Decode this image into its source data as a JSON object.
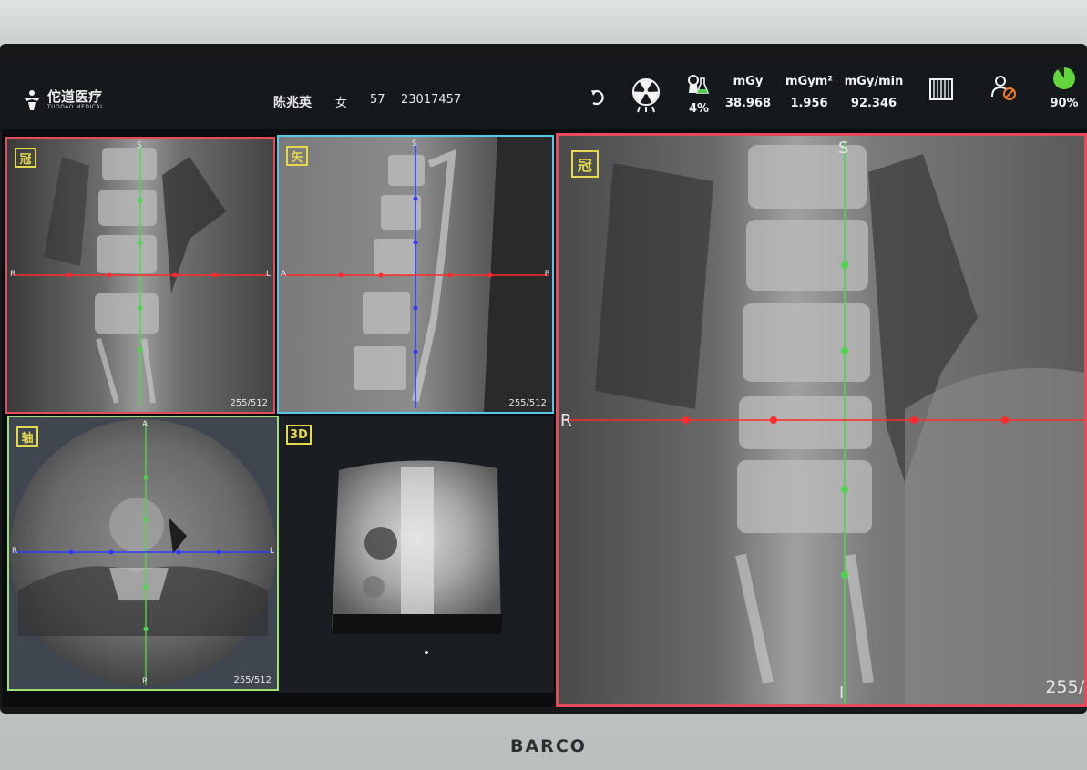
{
  "app": {
    "logo_cn": "佗道医疗",
    "logo_en": "TUODAO MEDICAL"
  },
  "patient": {
    "name": "陈兆英",
    "sex": "女",
    "age": "57",
    "id": "23017457"
  },
  "status": {
    "icons": [
      "return-icon",
      "radiation-icon",
      "contrast-flask-icon",
      "grid-icon",
      "user-block-icon",
      "battery-pie-icon"
    ],
    "contrast_pct": "4%",
    "dose_mgy_label": "mGy",
    "dose_mgy_value": "38.968",
    "dap_label": "mGym²",
    "dap_value": "1.956",
    "rate_label": "mGy/min",
    "rate_value": "92.346",
    "battery_pct": "90%",
    "battery_level": 0.9
  },
  "viewports": {
    "coronal": {
      "tag": "冠",
      "slice": "255/512",
      "top": "S",
      "left": "R",
      "right": "L"
    },
    "sagittal": {
      "tag": "矢",
      "slice": "255/512",
      "top": "S",
      "left": "A",
      "right": "P"
    },
    "axial": {
      "tag": "轴",
      "slice": "255/512",
      "top": "A",
      "bottom": "P",
      "left": "R",
      "right": "L"
    },
    "render3d": {
      "tag": "3D"
    },
    "main": {
      "tag": "冠",
      "slice": "255/",
      "top": "S",
      "left": "R",
      "bottom": "I"
    }
  },
  "colors": {
    "coronal_border": "#e64b5a",
    "sagittal_border": "#57c7e6",
    "axial_border": "#9fe07a",
    "tag_yellow": "#e4d94a",
    "crosshair_red": "#ff2a2a",
    "crosshair_green": "#4cd64c",
    "crosshair_blue": "#2a3cff"
  },
  "monitor": {
    "brand": "BARCO"
  }
}
